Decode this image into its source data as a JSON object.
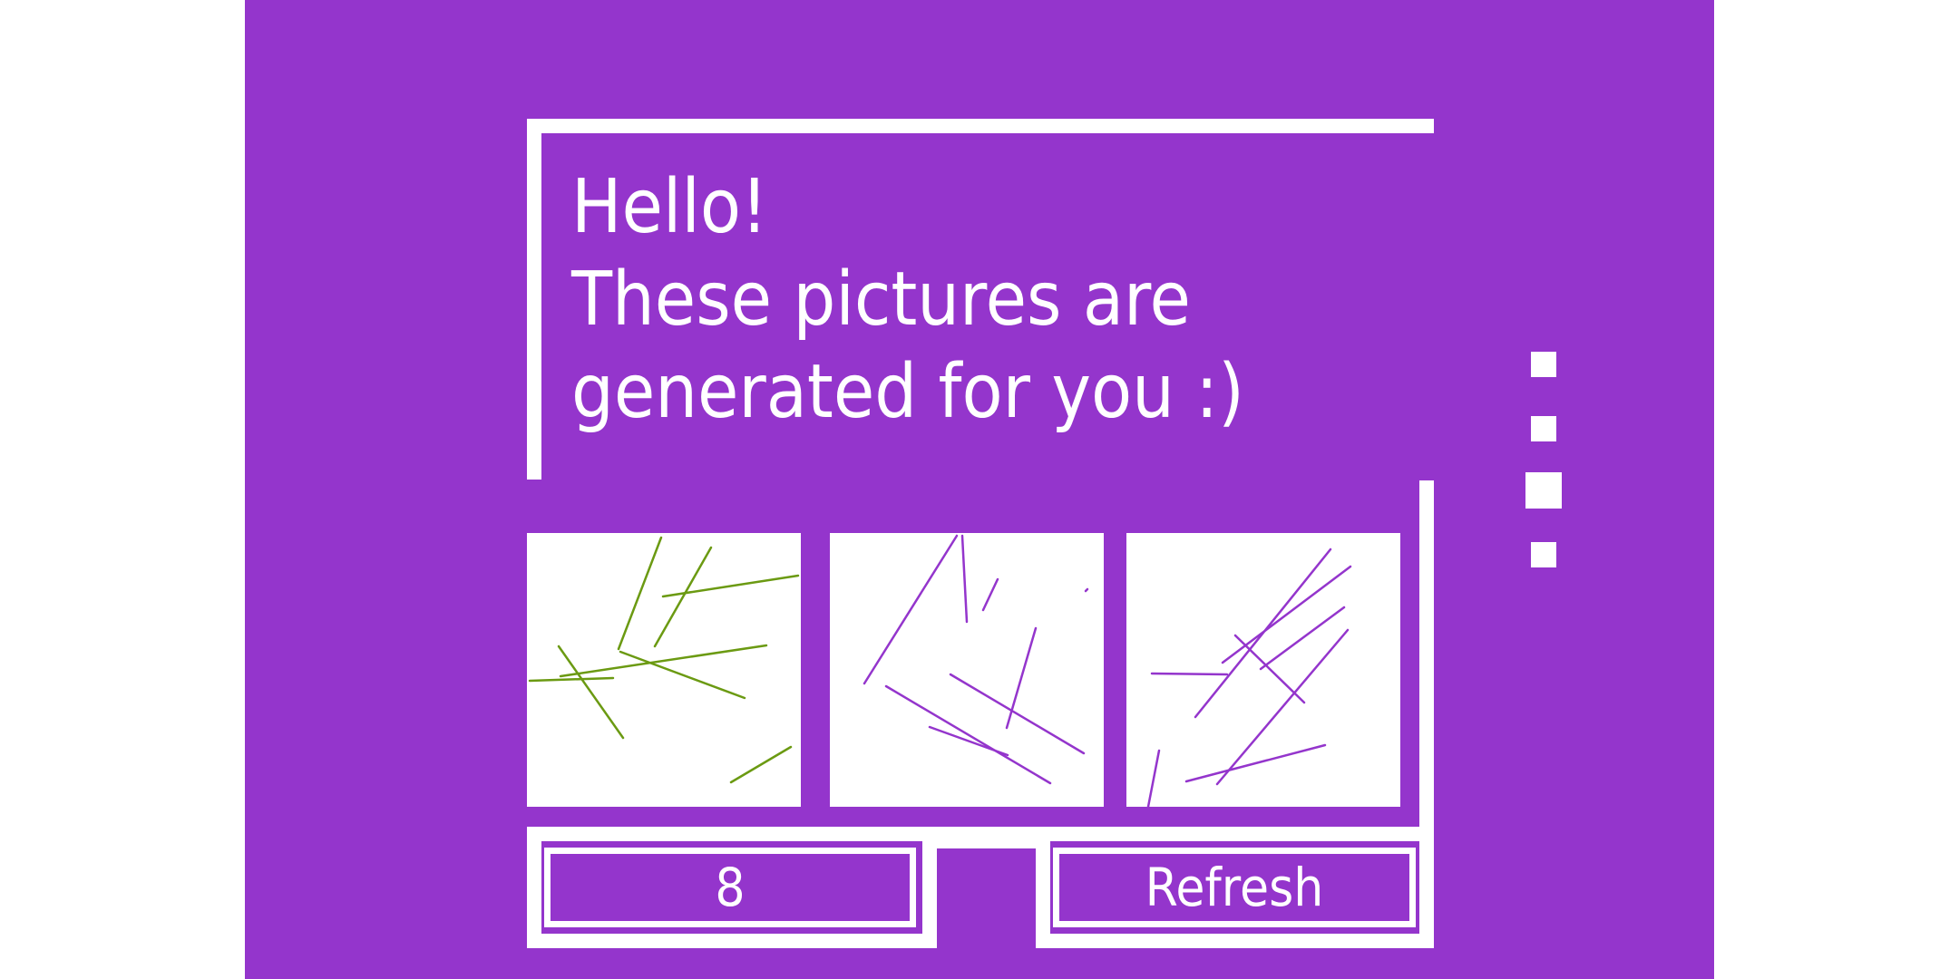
{
  "greeting": {
    "lines": [
      "Hello!",
      "These pictures are",
      "generated for you :)"
    ]
  },
  "pictures": [
    {
      "stroke_color": "#6b9a12"
    },
    {
      "stroke_color": "#9435cc"
    },
    {
      "stroke_color": "#9435cc"
    }
  ],
  "controls": {
    "count_value": "8",
    "refresh_label": "Refresh"
  },
  "colors": {
    "background": "#9435cc",
    "foreground": "#ffffff",
    "accent_green": "#6b9a12"
  },
  "side_indicator": {
    "dots": 4,
    "active_index": 2
  }
}
